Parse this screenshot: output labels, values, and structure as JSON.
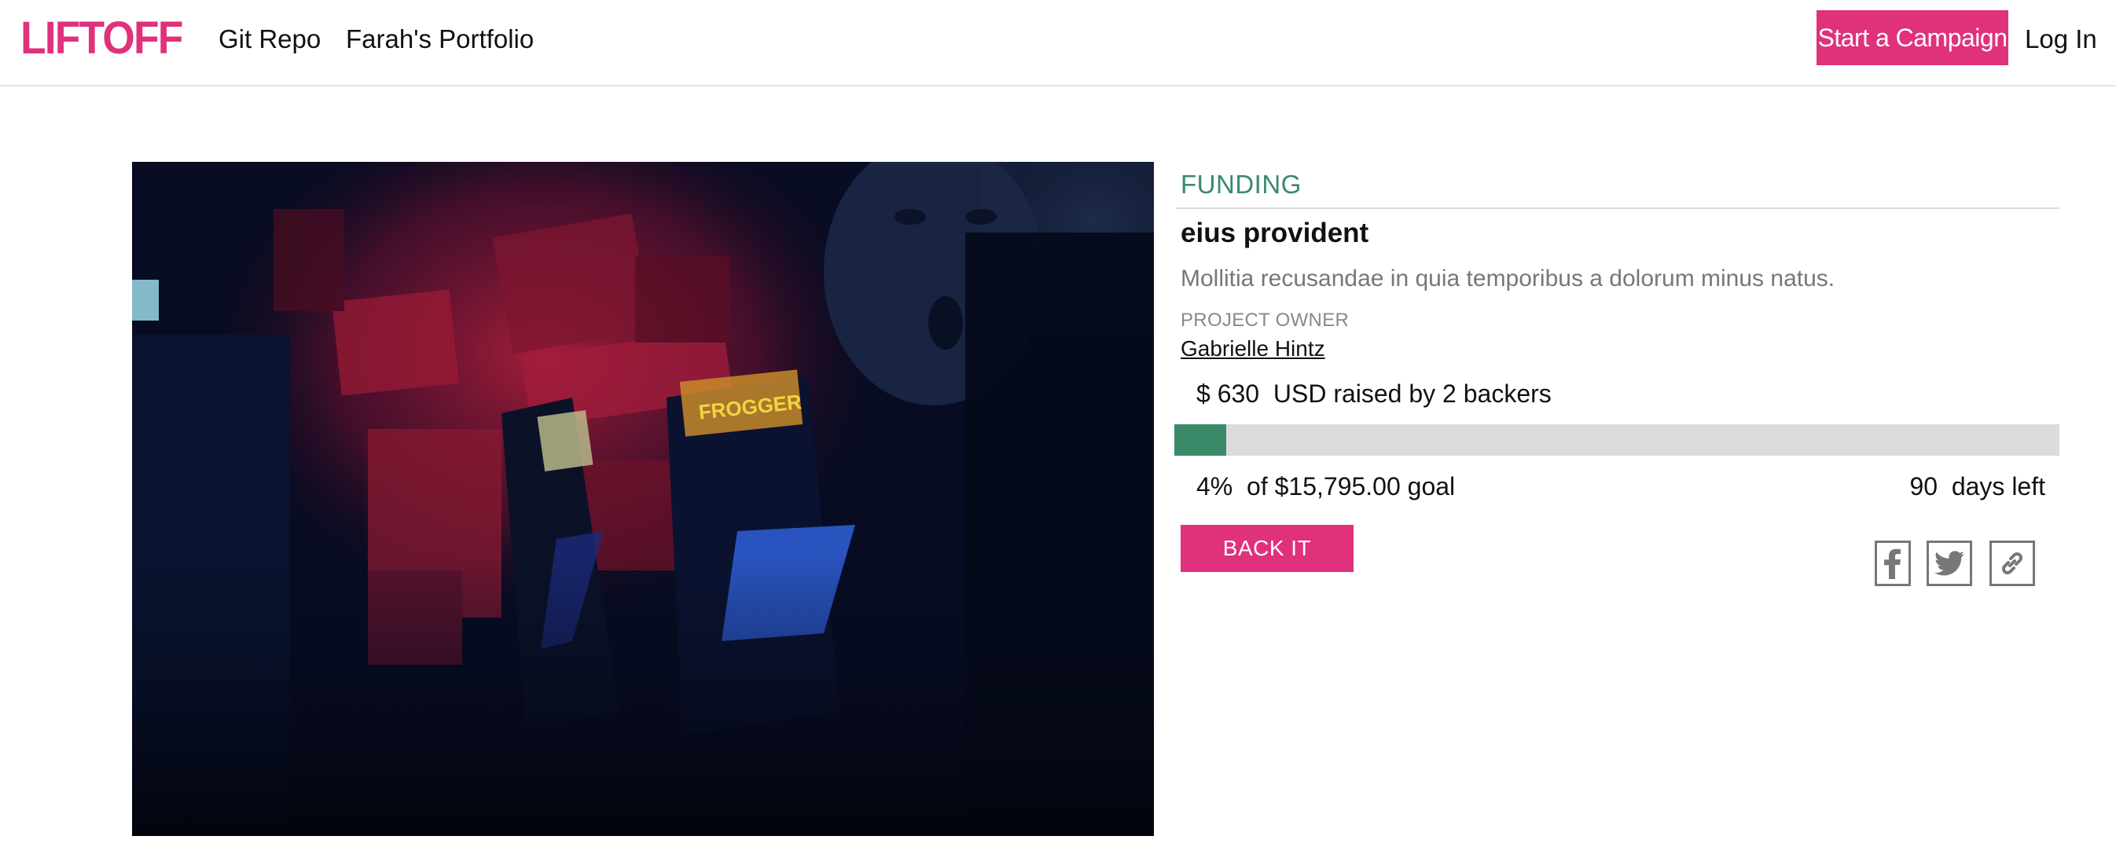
{
  "header": {
    "logo": "LIFTOFF",
    "nav": [
      "Git Repo",
      "Farah's Portfolio"
    ],
    "start_campaign": "Start a Campaign",
    "login": "Log In"
  },
  "project": {
    "status": "FUNDING",
    "title": "eius provident",
    "blurb": "Mollitia recusandae in quia temporibus a dolorum minus natus.",
    "owner_label": "PROJECT OWNER",
    "owner_name": "Gabrielle Hintz",
    "raised_text": "$ 630  USD raised by 2 backers",
    "progress_fraction": 0.04,
    "goal_text": "4%  of $15,795.00 goal",
    "days_text": "90  days left",
    "back_label": "BACK IT"
  },
  "share": {
    "icons": [
      "facebook-icon",
      "twitter-icon",
      "link-icon"
    ]
  },
  "hero_image": {
    "arcade_marquee": "FROGGER"
  },
  "colors": {
    "brand": "#e0317c",
    "funding_green": "#3a8a6a",
    "track_gray": "#dcdcdc"
  }
}
